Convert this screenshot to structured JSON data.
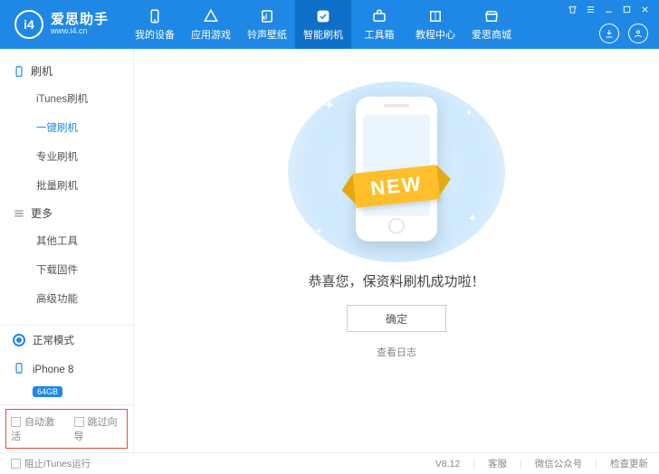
{
  "brand": {
    "name": "爱思助手",
    "url": "www.i4.cn",
    "logo": "i4"
  },
  "nav": {
    "items": [
      {
        "label": "我的设备",
        "icon": "device"
      },
      {
        "label": "应用游戏",
        "icon": "apps"
      },
      {
        "label": "铃声壁纸",
        "icon": "music"
      },
      {
        "label": "智能刷机",
        "icon": "flash",
        "active": true
      },
      {
        "label": "工具箱",
        "icon": "toolbox"
      },
      {
        "label": "教程中心",
        "icon": "book"
      },
      {
        "label": "爱思商城",
        "icon": "store"
      }
    ]
  },
  "sidebar": {
    "groups": [
      {
        "title": "刷机",
        "icon": "phone",
        "items": [
          {
            "label": "iTunes刷机"
          },
          {
            "label": "一键刷机",
            "active": true
          },
          {
            "label": "专业刷机"
          },
          {
            "label": "批量刷机"
          }
        ]
      },
      {
        "title": "更多",
        "icon": "more",
        "items": [
          {
            "label": "其他工具"
          },
          {
            "label": "下载固件"
          },
          {
            "label": "高级功能"
          }
        ]
      }
    ],
    "mode_label": "正常模式",
    "device_name": "iPhone 8",
    "storage_badge": "64GB",
    "options": {
      "auto_activate": "自动激活",
      "skip_guide": "跳过向导"
    }
  },
  "main": {
    "ribbon": "NEW",
    "success_text": "恭喜您，保资料刷机成功啦！",
    "ok_label": "确定",
    "log_link": "查看日志"
  },
  "footer": {
    "block_itunes": "阻止iTunes运行",
    "version": "V8.12",
    "support": "客服",
    "wechat": "微信公众号",
    "update": "检查更新"
  }
}
